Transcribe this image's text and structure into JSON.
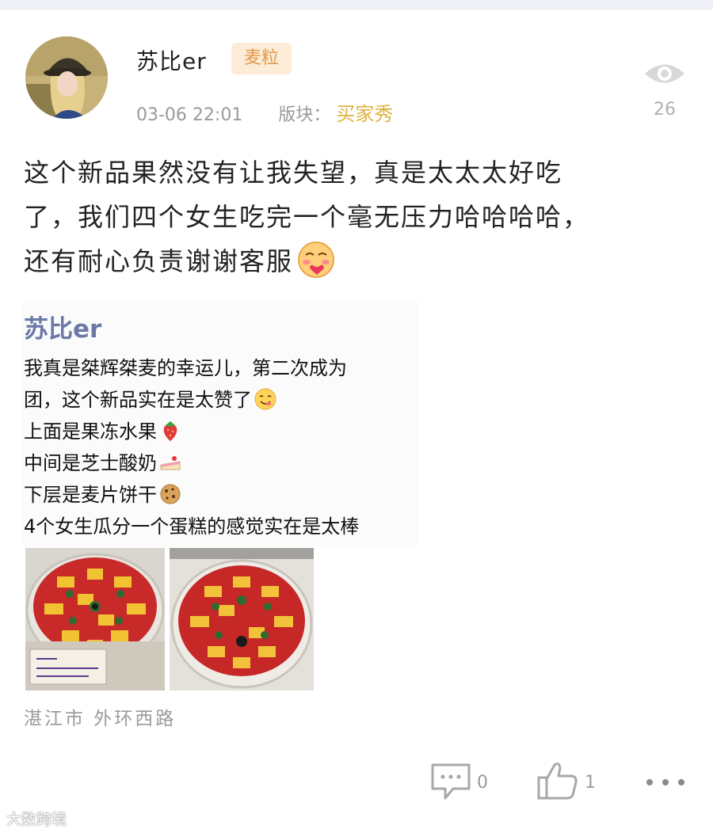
{
  "post": {
    "username": "苏比er",
    "badge": "麦粒",
    "timestamp": "03-06 22:01",
    "board_label": "版块：",
    "board_name": "买家秀",
    "views": "26",
    "text_line1": "这个新品果然没有让我失望，真是太太太好吃",
    "text_line2": "了，我们四个女生吃完一个毫无压力哈哈哈哈，",
    "text_line3": "还有耐心负责谢谢客服",
    "location": "湛江市 外环西路"
  },
  "embedded": {
    "username": "苏比er",
    "line1": "我真是桀辉桀麦的幸运儿，第二次成为",
    "line2": "团，这个新品实在是太赞了",
    "line3": "上面是果冻水果",
    "line4": "中间是芝士酸奶",
    "line5": "下层是麦片饼干",
    "line6": "4个女生瓜分一个蛋糕的感觉实在是太棒"
  },
  "actions": {
    "comment_count": "0",
    "like_count": "1"
  },
  "watermark": "大数跨境",
  "icons": {
    "views": "eye-icon",
    "comment": "comment-icon",
    "like": "thumbs-up-icon",
    "more": "more-icon"
  },
  "colors": {
    "badge_bg": "#fcebd6",
    "badge_text": "#e49a4a",
    "board_name": "#e0b23c",
    "embedded_username": "#6b78a8",
    "muted": "#9a9a9a"
  }
}
